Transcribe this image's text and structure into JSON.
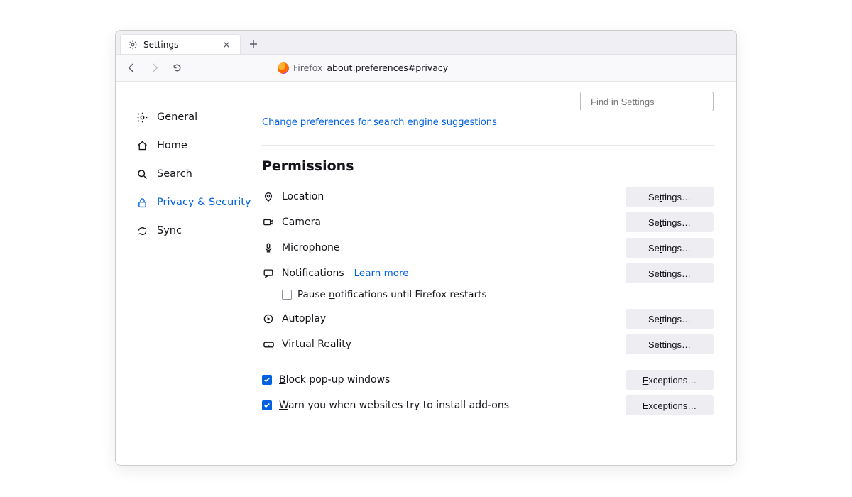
{
  "tab": {
    "title": "Settings"
  },
  "addressbar": {
    "label": "Firefox",
    "url": "about:preferences#privacy"
  },
  "sidebar": {
    "items": [
      {
        "label": "General"
      },
      {
        "label": "Home"
      },
      {
        "label": "Search"
      },
      {
        "label": "Privacy & Security"
      },
      {
        "label": "Sync"
      }
    ]
  },
  "search": {
    "placeholder": "Find in Settings"
  },
  "top_link": "Change preferences for search engine suggestions",
  "section_title": "Permissions",
  "permissions": {
    "location": {
      "label": "Location",
      "button": "Settings…"
    },
    "camera": {
      "label": "Camera",
      "button": "Settings…"
    },
    "microphone": {
      "label": "Microphone",
      "button": "Settings…"
    },
    "notifications": {
      "label": "Notifications",
      "learn_more": "Learn more",
      "button": "Settings…",
      "pause_label": "Pause notifications until Firefox restarts"
    },
    "autoplay": {
      "label": "Autoplay",
      "button": "Settings…"
    },
    "vr": {
      "label": "Virtual Reality",
      "button": "Settings…"
    }
  },
  "popups": {
    "label": "Block pop-up windows",
    "button": "Exceptions…"
  },
  "addons": {
    "label": "Warn you when websites try to install add-ons",
    "button": "Exceptions…"
  }
}
